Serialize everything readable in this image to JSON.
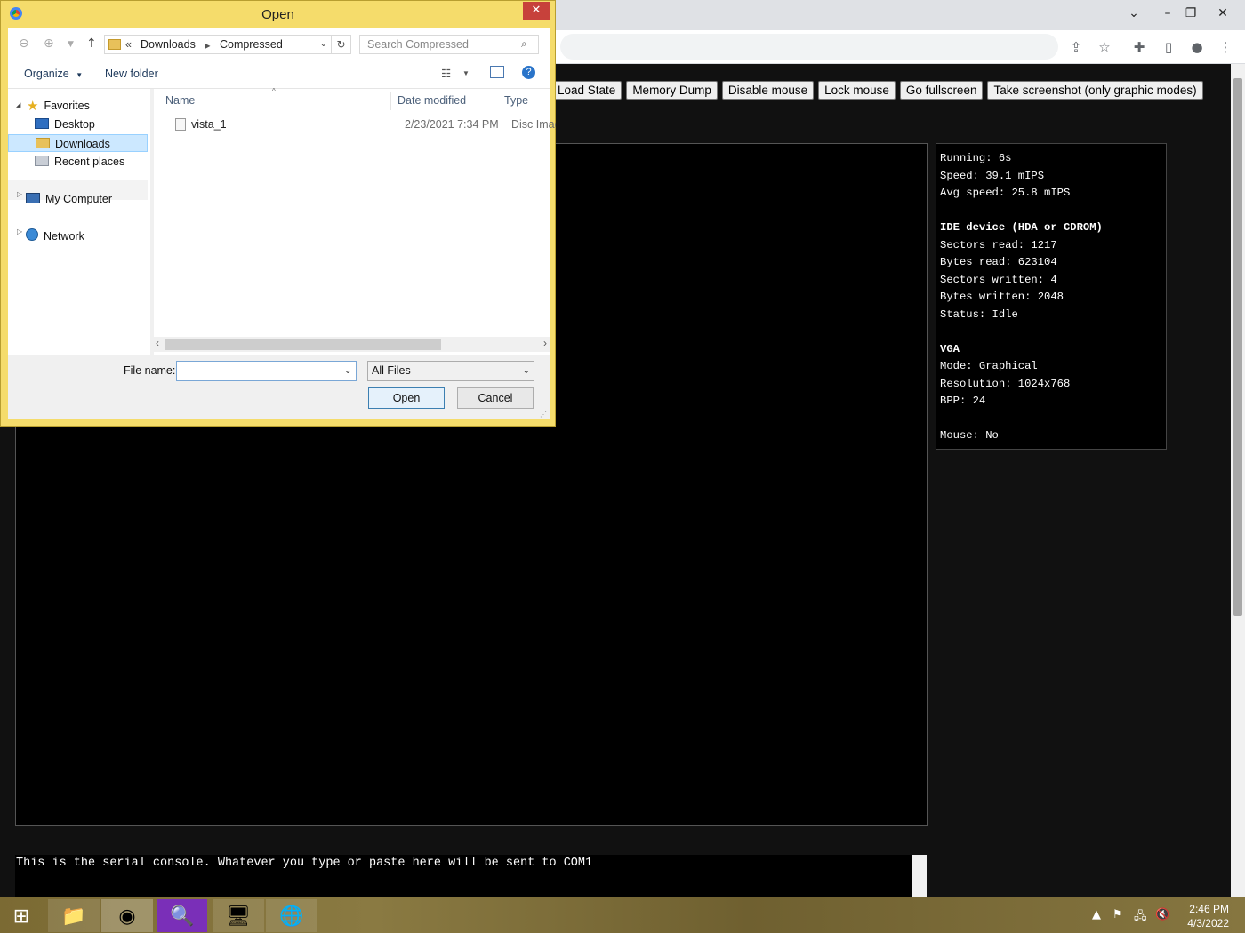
{
  "dialog": {
    "title": "Open",
    "address": {
      "crumbs": [
        "Downloads",
        "Compressed"
      ],
      "search_placeholder": "Search Compressed"
    },
    "toolbar": {
      "organize": "Organize",
      "new_folder": "New folder"
    },
    "nav": {
      "favorites": "Favorites",
      "desktop": "Desktop",
      "downloads": "Downloads",
      "recent": "Recent places",
      "computer": "My Computer",
      "network": "Network"
    },
    "columns": {
      "name": "Name",
      "date": "Date modified",
      "type": "Type"
    },
    "files": [
      {
        "name": "vista_1",
        "date": "2/23/2021 7:34 PM",
        "type": "Disc Imag"
      }
    ],
    "file_name_label": "File name:",
    "file_name_value": "",
    "filter": "All Files",
    "open_label": "Open",
    "cancel_label": "Cancel"
  },
  "emulator": {
    "buttons": [
      "Load State",
      "Memory Dump",
      "Disable mouse",
      "Lock mouse",
      "Go fullscreen",
      "Take screenshot (only graphic modes)"
    ],
    "stats": [
      "Running: 6s",
      "Speed: 39.1 mIPS",
      "Avg speed: 25.8 mIPS",
      "",
      "IDE device (HDA or CDROM)",
      "Sectors read: 1217",
      "Bytes read: 623104",
      "Sectors written: 4",
      "Bytes written: 2048",
      "Status: Idle",
      "",
      "VGA",
      "Mode: Graphical",
      "Resolution: 1024x768",
      "BPP: 24",
      "",
      "Mouse: No"
    ],
    "serial_text": "This is the serial console. Whatever you type or paste here will be sent to COM1"
  },
  "taskbar": {
    "time": "2:46 PM",
    "date": "4/3/2022"
  },
  "colors": {
    "dialog_frame": "#f5dc6b",
    "selection": "#cce8ff",
    "close": "#c7413b"
  }
}
